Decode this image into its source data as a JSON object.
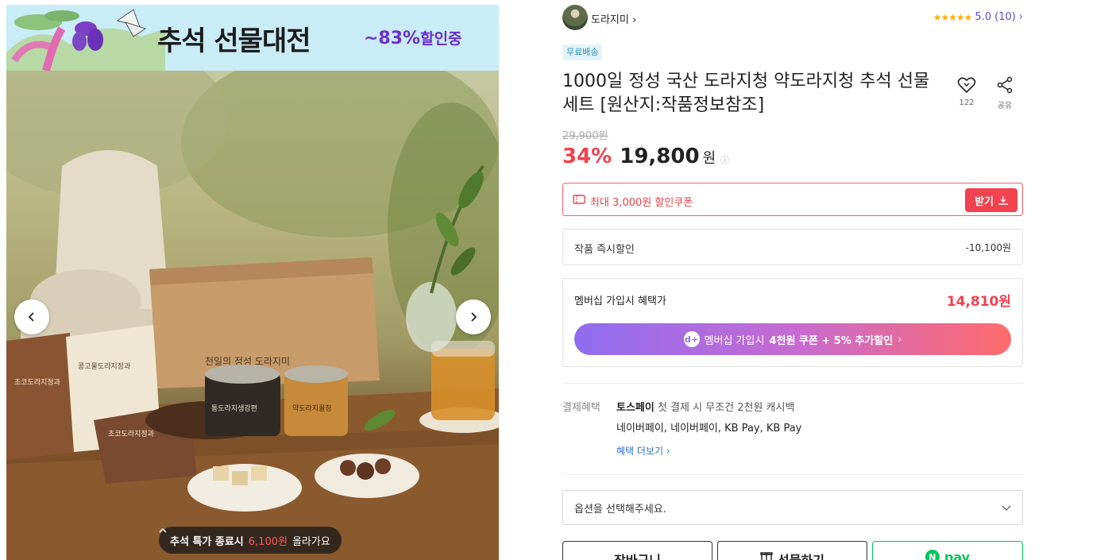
{
  "gallery": {
    "banner_title": "추석 선물대전",
    "banner_discount": "~83%",
    "banner_discount_suffix": "할인중",
    "box_brand_text": "천일의 정성 도라지미",
    "pouch_left_text": "초코도라지정과",
    "pouch_center_text": "콩고물도라지정과",
    "pouch_bottom_text": "초코도라지정과",
    "jar_left_text": "통도라지생강편",
    "jar_right_text": "약도라지꿀청",
    "pill_prefix": "추석 특가 종료시",
    "pill_highlight": "6,100원",
    "pill_suffix": "올라가요",
    "pill_icon": "chevron-up-icon",
    "prev_icon": "chevron-left-icon",
    "next_icon": "chevron-right-icon"
  },
  "seller": {
    "name": "도라지미",
    "name_arrow": "›",
    "stars": "★★★★★",
    "rating": "5.0",
    "review_count": "(10)",
    "rating_arrow": "›"
  },
  "product": {
    "shipping_badge": "무료배송",
    "title": "1000일 정성 국산 도라지청 약도라지청 추석 선물세트 [원산지:작품정보참조]",
    "like_count": "122",
    "share_label": "공유",
    "original_price": "29,900원",
    "discount_rate": "34%",
    "sale_price": "19,800",
    "currency": "원",
    "info_icon": "ⓘ"
  },
  "coupon": {
    "text": "최대 3,000원 할인쿠폰",
    "button_label": "받기",
    "icon": "coupon-icon"
  },
  "instant_discount": {
    "label": "작품 즉시할인",
    "value": "-10,100원"
  },
  "membership": {
    "label": "멤버십 가입시 혜택가",
    "price": "14,810원",
    "button_icon": "d+",
    "button_prefix": "멤버십 가입시",
    "button_highlight": "4천원 쿠폰 + 5% 추가할인",
    "button_arrow": "›"
  },
  "payment": {
    "label": "결제혜택",
    "line1_bold": "토스페이",
    "line1_rest": "첫 결제 시 무조건 2천원 캐시백",
    "line2": "네이버페이, 네이버페이, KB Pay, KB Pay",
    "more_link": "혜택 더보기 ›"
  },
  "options": {
    "placeholder": "옵션을 선택해주세요."
  },
  "actions": {
    "cart": "장바구니",
    "gift": "선물하기",
    "npay_mark": "N",
    "npay": "pay"
  },
  "colors": {
    "accent_red": "#f2414f",
    "rating_purple": "#5b4ad6",
    "npay_green": "#03c75a",
    "banner_bg": "#c9ecf7"
  }
}
